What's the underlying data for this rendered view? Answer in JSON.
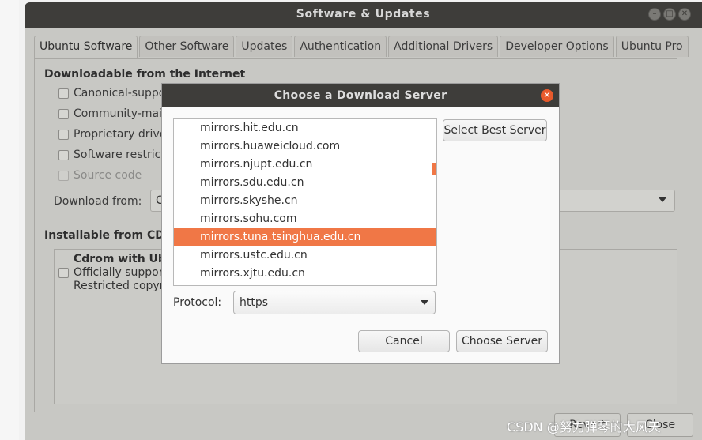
{
  "window": {
    "title": "Software & Updates"
  },
  "tabs": [
    {
      "label": "Ubuntu Software"
    },
    {
      "label": "Other Software"
    },
    {
      "label": "Updates"
    },
    {
      "label": "Authentication"
    },
    {
      "label": "Additional Drivers"
    },
    {
      "label": "Developer Options"
    },
    {
      "label": "Ubuntu Pro"
    }
  ],
  "main": {
    "downloadable_heading": "Downloadable from the Internet",
    "options": [
      {
        "label": "Canonical-suppor",
        "checked": false,
        "enabled": true
      },
      {
        "label": "Community-main",
        "checked": false,
        "enabled": true
      },
      {
        "label": "Proprietary drive",
        "checked": false,
        "enabled": true
      },
      {
        "label": "Software restrict",
        "checked": false,
        "enabled": true
      },
      {
        "label": "Source code",
        "checked": false,
        "enabled": false
      }
    ],
    "download_from_label": "Download from:",
    "download_from_value": "C",
    "installable_heading": "Installable from CD-R",
    "cdrom": {
      "title": "Cdrom with Ubu",
      "line1": "Officially support",
      "line2": "Restricted copyri"
    },
    "revert_label": "Revert",
    "close_label": "Close"
  },
  "dialog": {
    "title": "Choose a Download Server",
    "servers": [
      "mirrors.hit.edu.cn",
      "mirrors.huaweicloud.com",
      "mirrors.njupt.edu.cn",
      "mirrors.sdu.edu.cn",
      "mirrors.skyshe.cn",
      "mirrors.sohu.com",
      "mirrors.tuna.tsinghua.edu.cn",
      "mirrors.ustc.edu.cn",
      "mirrors.xjtu.edu.cn"
    ],
    "selected_server": "mirrors.tuna.tsinghua.edu.cn",
    "select_best_label": "Select Best Server",
    "protocol_label": "Protocol:",
    "protocol_value": "https",
    "cancel_label": "Cancel",
    "choose_label": "Choose Server"
  },
  "watermark": "CSDN @努力弹琴的大风天",
  "colors": {
    "accent": "#f07746",
    "titlebar": "#3e3d3a",
    "close_button": "#e85a2c"
  }
}
